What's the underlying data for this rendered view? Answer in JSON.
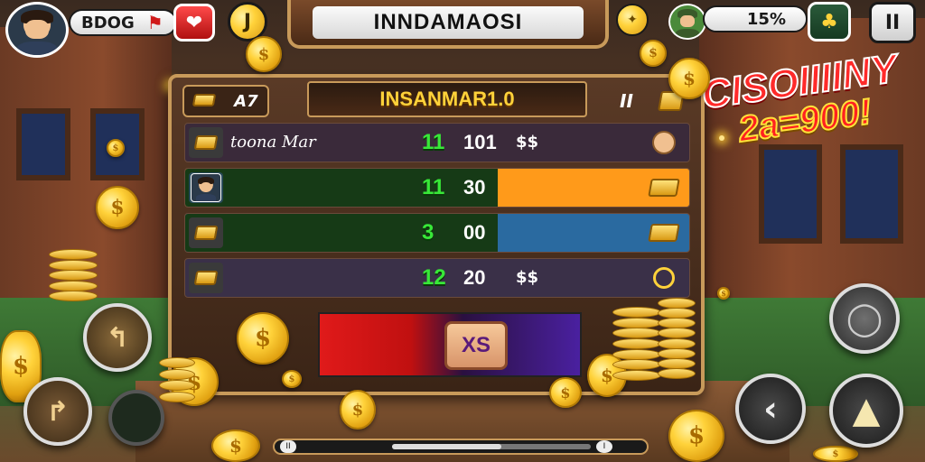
{
  "player": {
    "name": "BDOG",
    "avatar_icon": "player-avatar",
    "flag_icon": "flag-icon",
    "badge_icon": "heart-badge-icon"
  },
  "hud": {
    "title": "INNDAMAOSI",
    "coin_glyph": "J",
    "opponent_percent": "15%",
    "pause_label": "II",
    "opponent_badge_icon": "clover-icon"
  },
  "panel": {
    "head_left_text": "A7",
    "title": "INSANMAR1.0",
    "head_right_text": "II",
    "rows": [
      {
        "label": "toona Mar",
        "rank": "11",
        "score": "101",
        "unit": "$$",
        "fill": 0,
        "fill_color": "#3a2a3a",
        "end_icon": "face-icon"
      },
      {
        "label": "",
        "rank": "11",
        "score": "30",
        "unit": "",
        "fill": 1.0,
        "fill_color": "#ff9a1a",
        "end_icon": "gold-bar-icon"
      },
      {
        "label": "",
        "rank": "3",
        "score": "00",
        "unit": "",
        "fill": 1.0,
        "fill_color": "#2a6aa0",
        "end_icon": "gold-bar-icon"
      },
      {
        "label": "",
        "rank": "12",
        "score": "20",
        "unit": "$$",
        "fill": 0,
        "fill_color": "#3a3048",
        "end_icon": "timer-icon"
      }
    ],
    "action_label": "XS"
  },
  "promo": {
    "line1": "CISOIIIINY",
    "line2": "2a=900!"
  },
  "progress": {
    "left_glyph": "II",
    "right_glyph": "I",
    "value": 0.55
  },
  "coin_symbol": "$"
}
